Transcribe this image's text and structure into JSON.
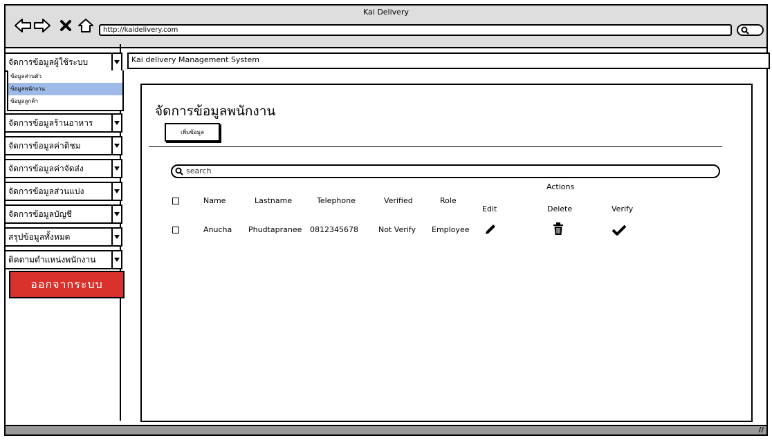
{
  "window": {
    "title": "Kai Delivery",
    "url": "http://kaidelivery.com"
  },
  "sidebar": {
    "menus": [
      "จัดการข้อมูลผู้ใช้ระบบ",
      "จัดการข้อมูลร้านอาหาร",
      "จัดการข้อมูลค่าติชม",
      "จัดการข้อมูลค่าจัดส่ง",
      "จัดการข้อมูลส่วนแบ่ง",
      "จัดการข้อมูลบัญชี",
      "สรุปข้อมูลทั้งหมด",
      "ติดตามตำแหน่งพนักงาน"
    ],
    "submenu": [
      "ข้อมูลส่วนตัว",
      "ข้อมูลพนักงาน",
      "ข้อมูลลูกค้า"
    ],
    "submenu_selected": "ข้อมูลพนักงาน",
    "logout_label": "ออกจากระบบ"
  },
  "header": {
    "system_title": "Kai delivery Management System"
  },
  "main": {
    "page_title": "จัดการข้อมูลพนักงาน",
    "add_button": "เพิ่มข้อมูล",
    "search_placeholder": "search",
    "actions_header": "Actions",
    "columns": [
      "Name",
      "Lastname",
      "Telephone",
      "Verified",
      "Role",
      "Edit",
      "Delete",
      "Verify"
    ],
    "rows": [
      {
        "name": "Anucha",
        "lastname": "Phudtapranee",
        "telephone": "0812345678",
        "verified": "Not Verify",
        "role": "Employee"
      }
    ]
  },
  "colors": {
    "accent_red": "#d9312c",
    "selection_blue": "#9ebbe8",
    "chrome_gray": "#dedede"
  },
  "icons": [
    "back-arrow-icon",
    "forward-arrow-icon",
    "close-icon",
    "home-icon",
    "search-icon",
    "pencil-icon",
    "trash-icon",
    "checkmark-icon",
    "resize-grip-icon"
  ]
}
